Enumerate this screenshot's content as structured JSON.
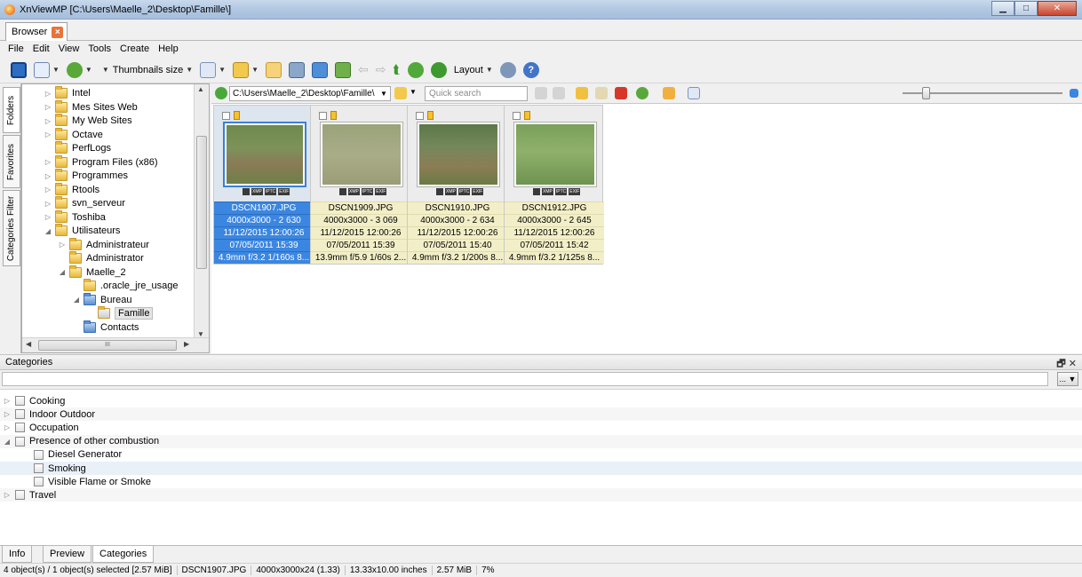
{
  "window": {
    "title": "XnViewMP [C:\\Users\\Maelle_2\\Desktop\\Famille\\]"
  },
  "tabs": [
    {
      "label": "Browser"
    }
  ],
  "menu": [
    "File",
    "Edit",
    "View",
    "Tools",
    "Create",
    "Help"
  ],
  "toolbar": {
    "thumbnails_size_label": "Thumbnails size",
    "layout_label": "Layout"
  },
  "side_tabs": [
    "Folders",
    "Favorites",
    "Categories Filter"
  ],
  "tree": [
    {
      "label": "Intel",
      "indent": 1,
      "expander": "closed"
    },
    {
      "label": "Mes Sites Web",
      "indent": 1,
      "expander": "closed"
    },
    {
      "label": "My Web Sites",
      "indent": 1,
      "expander": "closed"
    },
    {
      "label": "Octave",
      "indent": 1,
      "expander": "closed"
    },
    {
      "label": "PerfLogs",
      "indent": 1,
      "expander": "none"
    },
    {
      "label": "Program Files (x86)",
      "indent": 1,
      "expander": "closed"
    },
    {
      "label": "Programmes",
      "indent": 1,
      "expander": "closed"
    },
    {
      "label": "Rtools",
      "indent": 1,
      "expander": "closed"
    },
    {
      "label": "svn_serveur",
      "indent": 1,
      "expander": "closed"
    },
    {
      "label": "Toshiba",
      "indent": 1,
      "expander": "closed"
    },
    {
      "label": "Utilisateurs",
      "indent": 1,
      "expander": "open"
    },
    {
      "label": "Administrateur",
      "indent": 2,
      "expander": "closed"
    },
    {
      "label": "Administrator",
      "indent": 2,
      "expander": "none"
    },
    {
      "label": "Maelle_2",
      "indent": 2,
      "expander": "open"
    },
    {
      "label": ".oracle_jre_usage",
      "indent": 3,
      "expander": "none"
    },
    {
      "label": "Bureau",
      "indent": 3,
      "expander": "open",
      "blue": true
    },
    {
      "label": "Famille",
      "indent": 4,
      "expander": "none",
      "selected": true
    },
    {
      "label": "Contacts",
      "indent": 3,
      "expander": "none",
      "blue": true
    }
  ],
  "path": {
    "value": "C:\\Users\\Maelle_2\\Desktop\\Famille\\",
    "search_placeholder": "Quick search"
  },
  "thumbnails": [
    {
      "filename": "DSCN1907.JPG",
      "size": "4000x3000 - 2 630",
      "date1": "11/12/2015 12:00:26",
      "date2": "07/05/2011 15:39",
      "exif": "4.9mm f/3.2 1/160s 8...",
      "selected": true
    },
    {
      "filename": "DSCN1909.JPG",
      "size": "4000x3000 - 3 069",
      "date1": "11/12/2015 12:00:26",
      "date2": "07/05/2011 15:39",
      "exif": "13.9mm f/5.9 1/60s 2...",
      "selected": false
    },
    {
      "filename": "DSCN1910.JPG",
      "size": "4000x3000 - 2 634",
      "date1": "11/12/2015 12:00:26",
      "date2": "07/05/2011 15:40",
      "exif": "4.9mm f/3.2 1/200s 8...",
      "selected": false
    },
    {
      "filename": "DSCN1912.JPG",
      "size": "4000x3000 - 2 645",
      "date1": "11/12/2015 12:00:26",
      "date2": "07/05/2011 15:42",
      "exif": "4.9mm f/3.2 1/125s 8...",
      "selected": false
    }
  ],
  "thumb_badges": [
    "XMP",
    "IPTC",
    "EXIF"
  ],
  "categories_panel": {
    "title": "Categories",
    "dropdown_label": "...",
    "items": [
      {
        "label": "Cooking",
        "level": 0,
        "expander": "closed"
      },
      {
        "label": "Indoor Outdoor",
        "level": 0,
        "expander": "closed"
      },
      {
        "label": "Occupation",
        "level": 0,
        "expander": "closed"
      },
      {
        "label": "Presence of other combustion",
        "level": 0,
        "expander": "open"
      },
      {
        "label": "Diesel Generator",
        "level": 1,
        "expander": "none"
      },
      {
        "label": "Smoking",
        "level": 1,
        "expander": "none",
        "highlight": true
      },
      {
        "label": "Visible Flame or Smoke",
        "level": 1,
        "expander": "none"
      },
      {
        "label": "Travel",
        "level": 0,
        "expander": "closed"
      }
    ]
  },
  "bottom_tabs": [
    "Info",
    "Preview",
    "Categories"
  ],
  "status": [
    "4 object(s) / 1 object(s) selected [2.57 MiB]",
    "DSCN1907.JPG",
    "4000x3000x24 (1.33)",
    "13.33x10.00 inches",
    "2.57 MiB",
    "7%"
  ]
}
